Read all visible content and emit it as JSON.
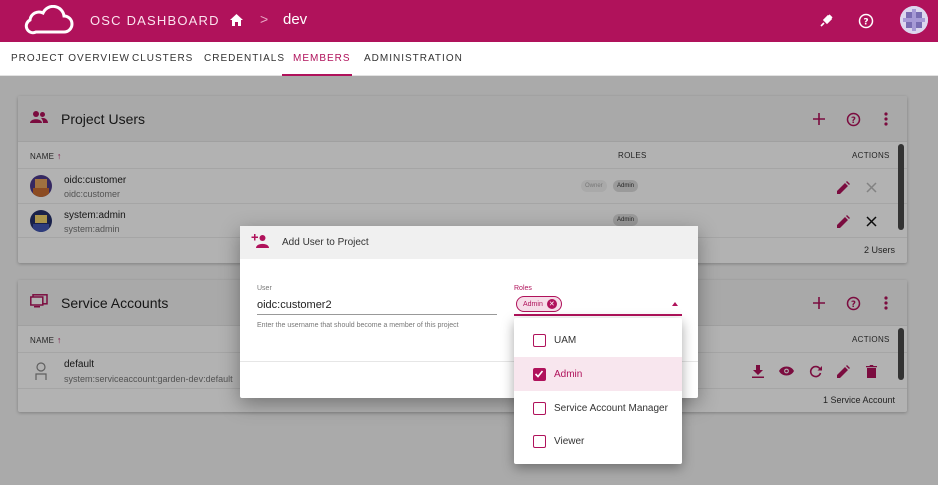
{
  "header": {
    "app_title": "OSC DASHBOARD",
    "breadcrumb_separator": ">",
    "breadcrumb_project": "dev",
    "brand_color": "#b0125b"
  },
  "tabs": [
    {
      "label": "PROJECT OVERVIEW",
      "active": false
    },
    {
      "label": "CLUSTERS",
      "active": false
    },
    {
      "label": "CREDENTIALS",
      "active": false
    },
    {
      "label": "MEMBERS",
      "active": true
    },
    {
      "label": "ADMINISTRATION",
      "active": false
    }
  ],
  "project_users": {
    "title": "Project Users",
    "columns": {
      "name": "NAME",
      "roles": "ROLES",
      "actions": "ACTIONS"
    },
    "rows": [
      {
        "name": "oidc:customer",
        "sub": "oidc:customer",
        "roles": [
          "Owner",
          "Admin"
        ]
      },
      {
        "name": "system:admin",
        "sub": "system:admin",
        "roles": [
          "Admin"
        ]
      }
    ],
    "count": "2 Users"
  },
  "service_accounts": {
    "title": "Service Accounts",
    "columns": {
      "name": "NAME",
      "actions": "ACTIONS"
    },
    "rows": [
      {
        "name": "default",
        "sub": "system:serviceaccount:garden-dev:default"
      }
    ],
    "count": "1 Service Account"
  },
  "dialog": {
    "title": "Add User to Project",
    "user_label": "User",
    "user_value": "oidc:customer2",
    "user_hint": "Enter the username that should become a member of this project",
    "roles_label": "Roles",
    "selected_role": "Admin"
  },
  "role_menu": {
    "items": [
      {
        "label": "UAM",
        "checked": false
      },
      {
        "label": "Admin",
        "checked": true
      },
      {
        "label": "Service Account Manager",
        "checked": false
      },
      {
        "label": "Viewer",
        "checked": false
      }
    ]
  },
  "icons": {
    "logo": "cloud-icon",
    "home": "home-icon",
    "plug": "plug-icon",
    "help": "help-circle-icon"
  }
}
